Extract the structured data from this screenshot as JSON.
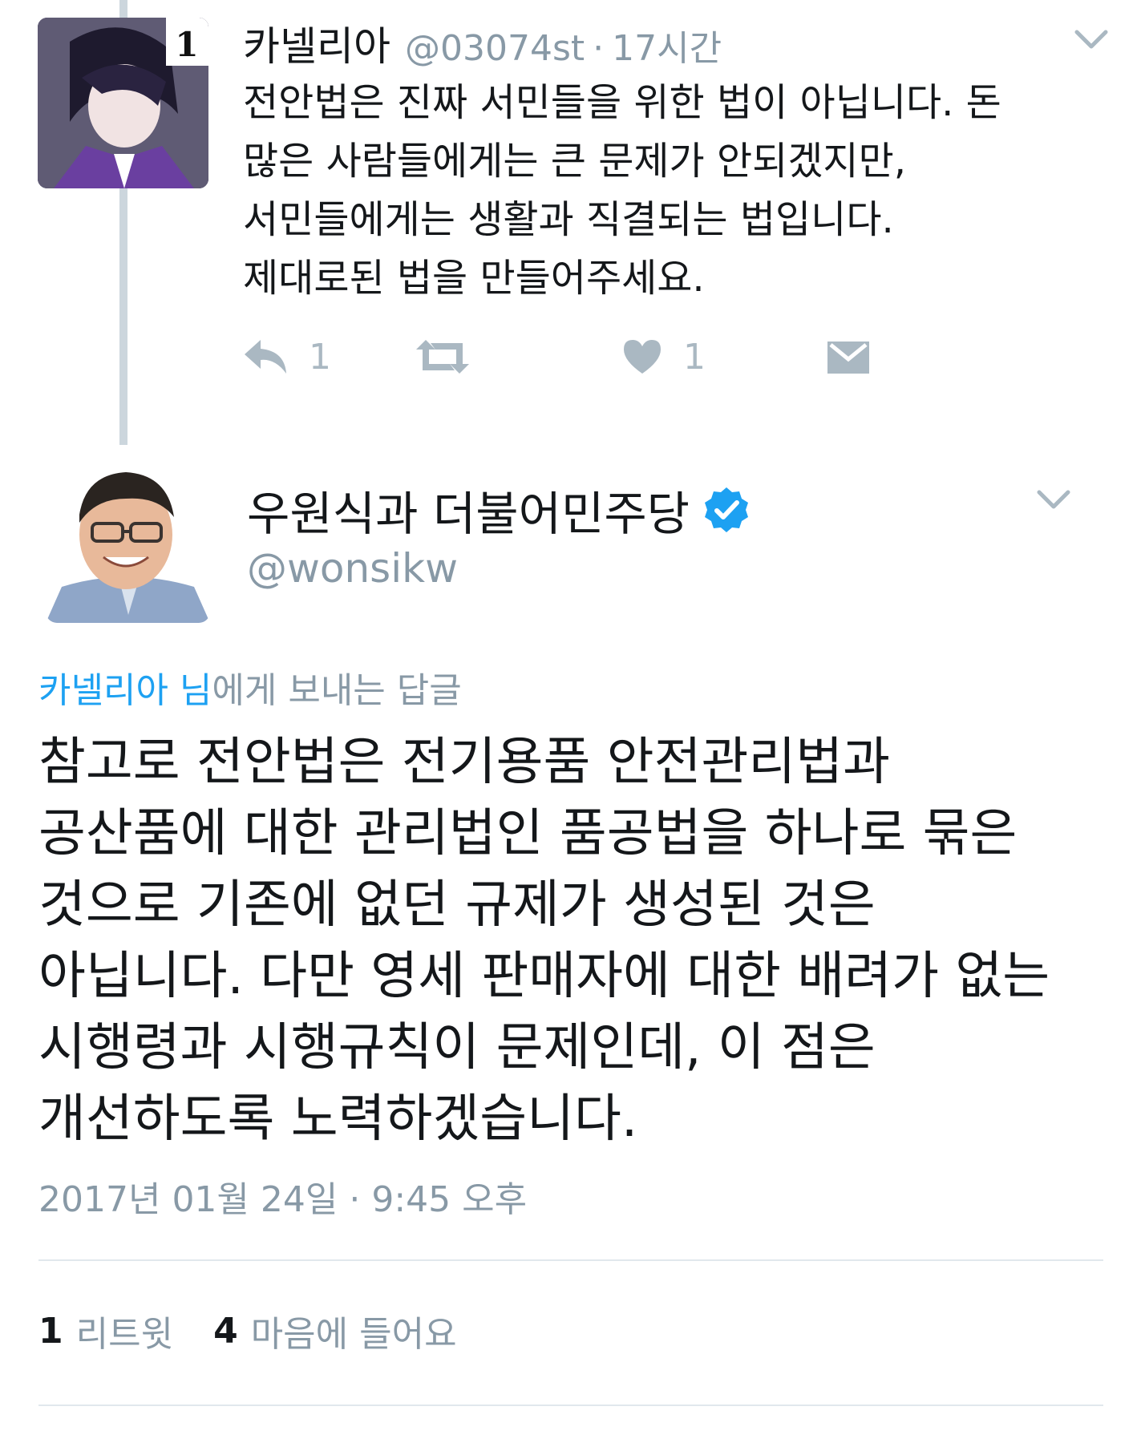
{
  "parent_tweet": {
    "display_name": "카넬리아",
    "handle": "@03074st",
    "separator": "·",
    "time": "17시간",
    "text": "전안법은 진짜 서민들을 위한 법이 아닙니다. 돈\n많은 사람들에게는 큰 문제가 안되겠지만,\n서민들에게는 생활과 직결되는 법입니다.\n제대로된 법을 만들어주세요.",
    "reply_count": "1",
    "like_count": "1",
    "avatar_badge": "1"
  },
  "main_tweet": {
    "display_name": "우원식과 더불어민주당",
    "handle": "@wonsikw",
    "reply_to_mention": "카넬리아 님",
    "reply_to_suffix": "에게 보내는 답글",
    "text": "참고로 전안법은 전기용품 안전관리법과\n공산품에 대한 관리법인 품공법을 하나로 묶은\n것으로 기존에 없던 규제가 생성된 것은\n아닙니다. 다만 영세 판매자에 대한 배려가 없는\n시행령과 시행규칙이 문제인데, 이 점은\n개선하도록 노력하겠습니다.",
    "timestamp": "2017년 01월 24일 · 9:45 오후",
    "retweet_count": "1",
    "retweet_label": "리트윗",
    "like_count": "4",
    "like_label": "마음에 들어요"
  },
  "colors": {
    "text": "#14171a",
    "muted": "#8899a6",
    "icon": "#aab8c2",
    "link": "#1da1f2",
    "verified": "#1da1f2",
    "divider": "#e1e8ed",
    "thread_line": "#ccd6dd"
  },
  "icons": [
    "reply-icon",
    "retweet-icon",
    "heart-icon",
    "direct-message-icon",
    "chevron-down-icon",
    "verified-badge-icon"
  ]
}
